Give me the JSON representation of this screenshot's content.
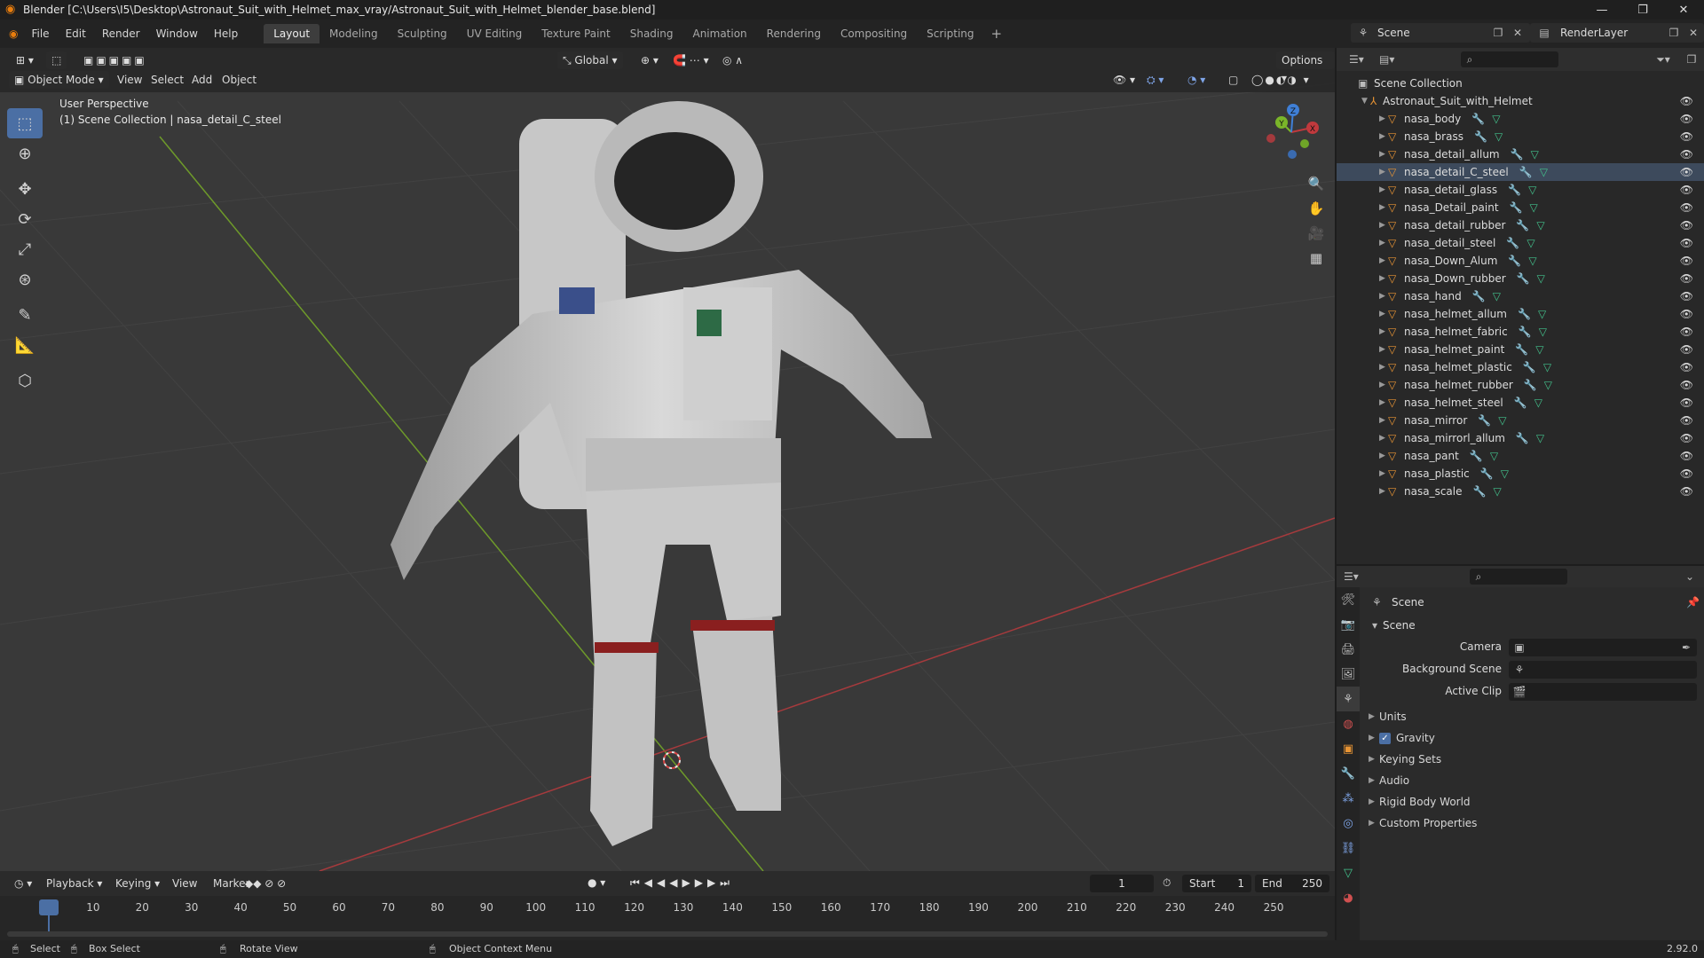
{
  "window": {
    "title": "Blender [C:\\Users\\I5\\Desktop\\Astronaut_Suit_with_Helmet_max_vray/Astronaut_Suit_with_Helmet_blender_base.blend]",
    "minimize": "—",
    "maximize": "❐",
    "close": "✕"
  },
  "menu": [
    "File",
    "Edit",
    "Render",
    "Window",
    "Help"
  ],
  "workspaces": [
    "Layout",
    "Modeling",
    "Sculpting",
    "UV Editing",
    "Texture Paint",
    "Shading",
    "Animation",
    "Rendering",
    "Compositing",
    "Scripting"
  ],
  "active_workspace": "Layout",
  "scene_name": "Scene",
  "render_layer": "RenderLayer",
  "viewport": {
    "mode": "Object Mode",
    "menus": [
      "View",
      "Select",
      "Add",
      "Object"
    ],
    "orientation": "Global",
    "options": "Options",
    "info_line1": "User Perspective",
    "info_line2": "(1) Scene Collection | nasa_detail_C_steel",
    "gizmo": {
      "x": "X",
      "y": "Y",
      "z": "Z"
    }
  },
  "outliner": {
    "root": "Scene Collection",
    "collection": "Astronaut_Suit_with_Helmet",
    "selected": "nasa_detail_C_steel",
    "items": [
      "nasa_body",
      "nasa_brass",
      "nasa_detail_allum",
      "nasa_detail_C_steel",
      "nasa_detail_glass",
      "nasa_Detail_paint",
      "nasa_detail_rubber",
      "nasa_detail_steel",
      "nasa_Down_Alum",
      "nasa_Down_rubber",
      "nasa_hand",
      "nasa_helmet_allum",
      "nasa_helmet_fabric",
      "nasa_helmet_paint",
      "nasa_helmet_plastic",
      "nasa_helmet_rubber",
      "nasa_helmet_steel",
      "nasa_mirror",
      "nasa_mirrorl_allum",
      "nasa_pant",
      "nasa_plastic",
      "nasa_scale"
    ]
  },
  "properties": {
    "context": "Scene",
    "panel": "Scene",
    "fields": [
      {
        "label": "Camera"
      },
      {
        "label": "Background Scene"
      },
      {
        "label": "Active Clip"
      }
    ],
    "subpanels": [
      "Units",
      "Gravity",
      "Keying Sets",
      "Audio",
      "Rigid Body World",
      "Custom Properties"
    ],
    "gravity_checked": true
  },
  "timeline": {
    "menus": [
      "Playback",
      "Keying",
      "View",
      "Marker"
    ],
    "current_frame": "1",
    "start_label": "Start",
    "start": "1",
    "end_label": "End",
    "end": "250",
    "ticks": [
      "1",
      "10",
      "20",
      "30",
      "40",
      "50",
      "60",
      "70",
      "80",
      "90",
      "100",
      "110",
      "120",
      "130",
      "140",
      "150",
      "160",
      "170",
      "180",
      "190",
      "200",
      "210",
      "220",
      "230",
      "240",
      "250"
    ]
  },
  "statusbar": {
    "select": "Select",
    "box_select": "Box Select",
    "rotate_view": "Rotate View",
    "context_menu": "Object Context Menu",
    "version": "2.92.0"
  },
  "colors": {
    "accent": "#4b6fa4",
    "object_icon": "#e89434",
    "modifier_icon": "#7fa5e8",
    "mesh_icon": "#43c28c",
    "x_axis": "#c0393d",
    "y_axis": "#7ab529"
  }
}
